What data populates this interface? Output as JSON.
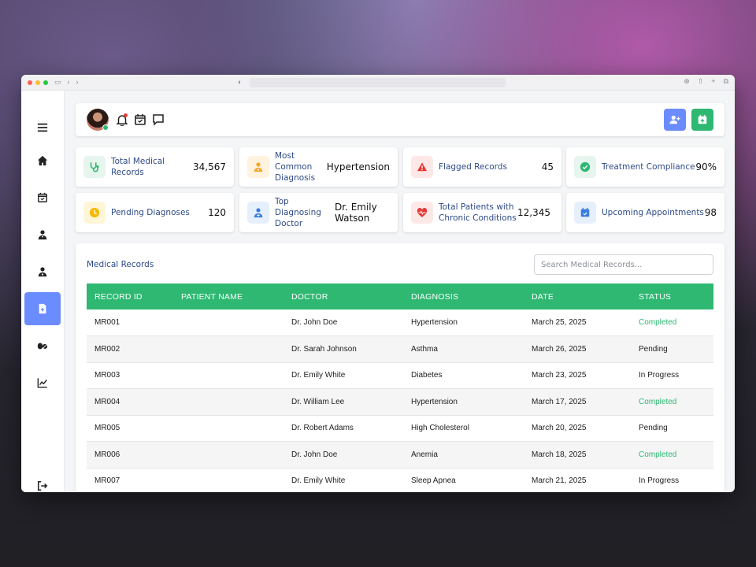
{
  "browser": {
    "dots": [
      "#ff5f57",
      "#febc2e",
      "#28c840"
    ]
  },
  "sidebar": {
    "items": [
      {
        "icon": "menu-icon"
      },
      {
        "icon": "home-icon"
      },
      {
        "icon": "calendar-icon"
      },
      {
        "icon": "doctor-icon"
      },
      {
        "icon": "patient-icon"
      },
      {
        "icon": "medical-file-icon",
        "active": true
      },
      {
        "icon": "pills-icon"
      },
      {
        "icon": "chart-icon"
      },
      {
        "icon": "logout-icon"
      }
    ]
  },
  "colors": {
    "accent_green": "#2eb872",
    "accent_blue": "#6b8cff",
    "label_blue": "#2d4a86",
    "alert_red": "#e53935"
  },
  "cards": [
    {
      "label": "Total Medical Records",
      "value": "34,567",
      "icon": "stethoscope-icon",
      "color": "#2eb872",
      "bg": "#e6f6ee"
    },
    {
      "label": "Most Common Diagnosis",
      "value": "Hypertension",
      "icon": "doctor-badge-icon",
      "color": "#f5a623",
      "bg": "#fff3e0"
    },
    {
      "label": "Flagged Records",
      "value": "45",
      "icon": "warning-icon",
      "color": "#e53935",
      "bg": "#fde8e8"
    },
    {
      "label": "Treatment Compliance",
      "value": "90%",
      "icon": "check-circle-icon",
      "color": "#2eb872",
      "bg": "#e6f6ee"
    },
    {
      "label": "Pending Diagnoses",
      "value": "120",
      "icon": "clock-icon",
      "color": "#f5b800",
      "bg": "#fff6d8"
    },
    {
      "label": "Top Diagnosing Doctor",
      "value": "Dr. Emily Watson",
      "icon": "doctor-icon",
      "color": "#3b7ddd",
      "bg": "#e6f0fc"
    },
    {
      "label": "Total Patients with Chronic Conditions",
      "value": "12,345",
      "icon": "heart-pulse-icon",
      "color": "#e53935",
      "bg": "#fde8e8"
    },
    {
      "label": "Upcoming Appointments",
      "value": "98",
      "icon": "calendar-check-icon",
      "color": "#3b7ddd",
      "bg": "#e6f0fc"
    }
  ],
  "records": {
    "title": "Medical Records",
    "search_placeholder": "Search Medical Records...",
    "columns": [
      "RECORD ID",
      "PATIENT NAME",
      "DOCTOR",
      "DIAGNOSIS",
      "DATE",
      "STATUS"
    ],
    "rows": [
      {
        "id": "MR001",
        "patient": "",
        "doctor": "Dr. John Doe",
        "diagnosis": "Hypertension",
        "date": "March 25, 2025",
        "status": "Completed"
      },
      {
        "id": "MR002",
        "patient": "",
        "doctor": "Dr. Sarah Johnson",
        "diagnosis": "Asthma",
        "date": "March 26, 2025",
        "status": "Pending"
      },
      {
        "id": "MR003",
        "patient": "",
        "doctor": "Dr. Emily White",
        "diagnosis": "Diabetes",
        "date": "March 23, 2025",
        "status": "In Progress"
      },
      {
        "id": "MR004",
        "patient": "",
        "doctor": "Dr. William Lee",
        "diagnosis": "Hypertension",
        "date": "March 17, 2025",
        "status": "Completed"
      },
      {
        "id": "MR005",
        "patient": "",
        "doctor": "Dr. Robert Adams",
        "diagnosis": "High Cholesterol",
        "date": "March 20, 2025",
        "status": "Pending"
      },
      {
        "id": "MR006",
        "patient": "",
        "doctor": "Dr. John Doe",
        "diagnosis": "Anemia",
        "date": "March 18, 2025",
        "status": "Completed"
      },
      {
        "id": "MR007",
        "patient": "",
        "doctor": "Dr. Emily White",
        "diagnosis": "Sleep Apnea",
        "date": "March 21, 2025",
        "status": "In Progress"
      }
    ]
  }
}
